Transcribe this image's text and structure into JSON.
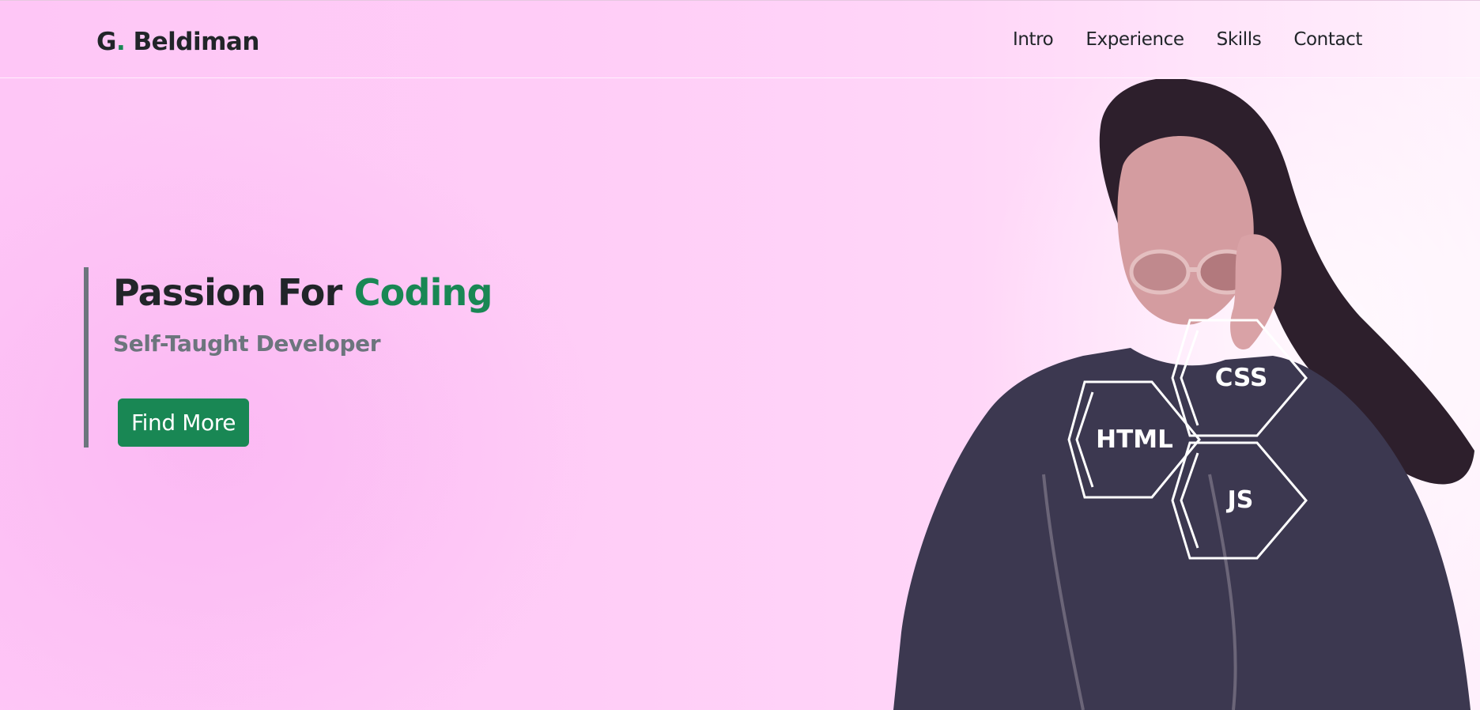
{
  "nav": {
    "brand_initial": "G",
    "brand_dot": ".",
    "brand_name": " Beldiman",
    "links": [
      "Intro",
      "Experience",
      "Skills",
      "Contact"
    ]
  },
  "hero": {
    "title_main": "Passion For ",
    "title_accent": "Coding",
    "subtitle": "Self-Taught Developer",
    "button_label": "Find More"
  },
  "skills_badges": [
    "CSS",
    "HTML",
    "JS"
  ],
  "colors": {
    "accent": "#198754",
    "muted": "#6c757d",
    "text": "#212529",
    "background": "#fec6f6"
  },
  "icons": [
    "hexagon-css-icon",
    "hexagon-html-icon",
    "hexagon-js-icon"
  ]
}
